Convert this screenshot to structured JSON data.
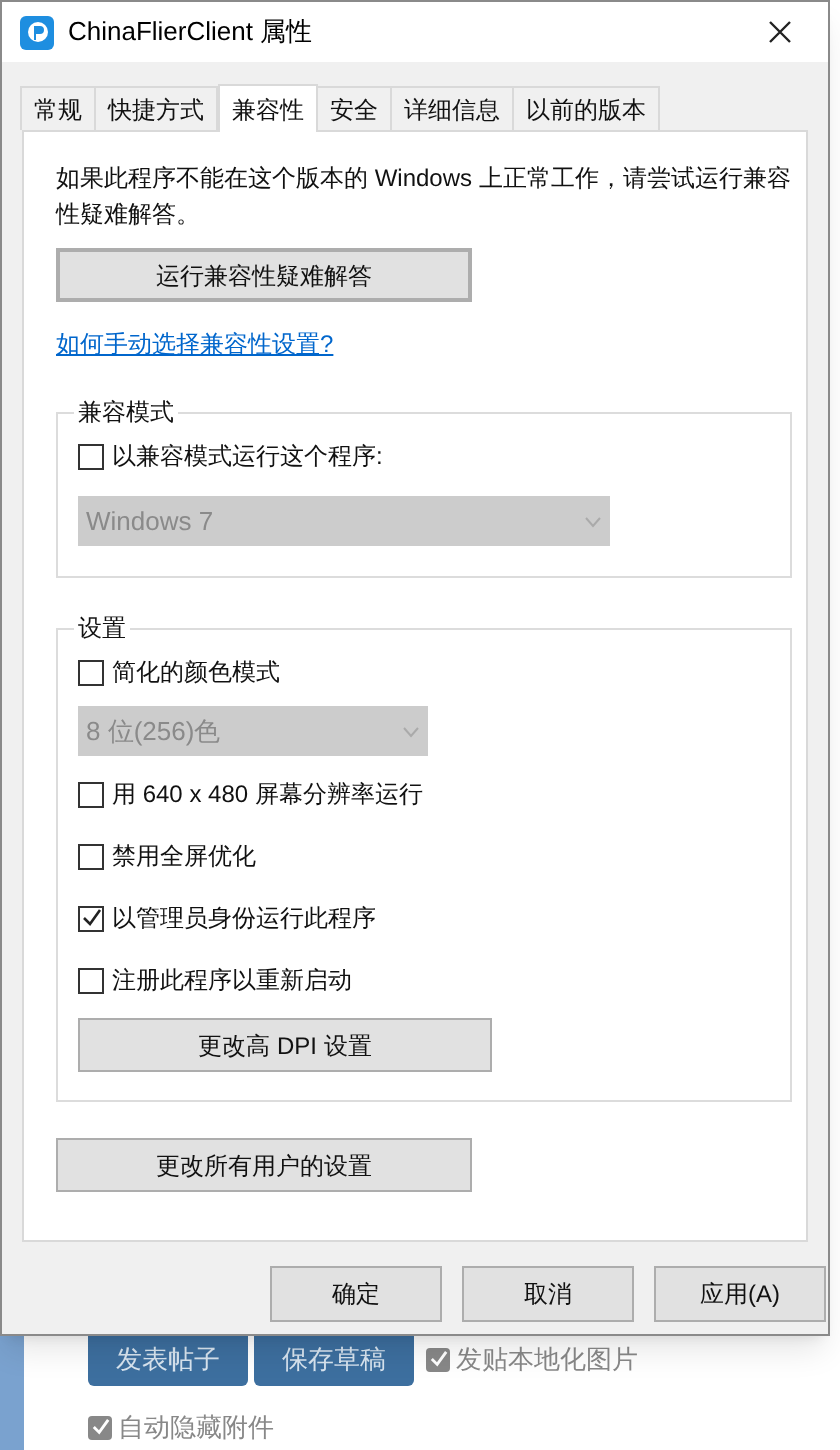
{
  "window": {
    "title": "ChinaFlierClient 属性"
  },
  "tabs": [
    {
      "label": "常规",
      "selected": false
    },
    {
      "label": "快捷方式",
      "selected": false
    },
    {
      "label": "兼容性",
      "selected": true
    },
    {
      "label": "安全",
      "selected": false
    },
    {
      "label": "详细信息",
      "selected": false
    },
    {
      "label": "以前的版本",
      "selected": false
    }
  ],
  "description": "如果此程序不能在这个版本的 Windows 上正常工作，请尝试运行兼容性疑难解答。",
  "troubleshoot_button": "运行兼容性疑难解答",
  "help_link": "如何手动选择兼容性设置?",
  "compat_mode": {
    "title": "兼容模式",
    "checkbox": {
      "label": "以兼容模式运行这个程序:",
      "checked": false
    },
    "dropdown": {
      "value": "Windows 7",
      "disabled": true
    }
  },
  "settings": {
    "title": "设置",
    "items": [
      {
        "kind": "checkbox",
        "label": "简化的颜色模式",
        "checked": false
      },
      {
        "kind": "dropdown",
        "value": "8 位(256)色",
        "disabled": true
      },
      {
        "kind": "checkbox",
        "label": "用 640 x 480 屏幕分辨率运行",
        "checked": false
      },
      {
        "kind": "checkbox",
        "label": "禁用全屏优化",
        "checked": false
      },
      {
        "kind": "checkbox",
        "label": "以管理员身份运行此程序",
        "checked": true
      },
      {
        "kind": "checkbox",
        "label": "注册此程序以重新启动",
        "checked": false
      },
      {
        "kind": "button",
        "label": "更改高 DPI 设置"
      }
    ]
  },
  "all_users_button": "更改所有用户的设置",
  "buttons": [
    "确定",
    "取消",
    "应用(A)"
  ],
  "background": {
    "buttons": [
      "发表帖子",
      "保存草稿"
    ],
    "checkboxes": [
      {
        "label": "发贴本地化图片",
        "checked": true
      },
      {
        "label": "自动隐藏附件",
        "checked": true
      }
    ]
  }
}
